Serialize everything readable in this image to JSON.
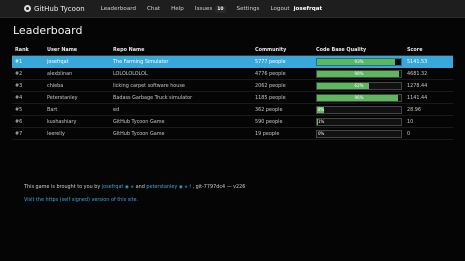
{
  "navbar": {
    "brand": "GitHub Tycoon",
    "items": [
      {
        "label": "Leaderboard"
      },
      {
        "label": "Chat"
      },
      {
        "label": "Help"
      },
      {
        "label": "Issues",
        "badge": "10"
      },
      {
        "label": "Settings"
      },
      {
        "label": "Logout"
      }
    ],
    "user": "josefrqat"
  },
  "page": {
    "title": "Leaderboard"
  },
  "table": {
    "headers": [
      "Rank",
      "User Name",
      "Repo Name",
      "Community",
      "Code Base Quality",
      "Score"
    ],
    "rows": [
      {
        "rank": "#1",
        "user": "josefrqat",
        "repo": "The Farming Simulator",
        "community": "5777 people",
        "quality_label": "93%",
        "quality": 93,
        "score": "5141.53",
        "highlight": true
      },
      {
        "rank": "#2",
        "user": "alexblinan",
        "repo": "LOLOLOLOLOL",
        "community": "4776 people",
        "quality_label": "98%",
        "quality": 98,
        "score": "4681.32",
        "highlight": false
      },
      {
        "rank": "#3",
        "user": "chieba",
        "repo": "licking carpet software house",
        "community": "2062 people",
        "quality_label": "62%",
        "quality": 62,
        "score": "1278.44",
        "highlight": false
      },
      {
        "rank": "#4",
        "user": "Peterstanley",
        "repo": "Badass Garbage Truck simulator",
        "community": "1185 people",
        "quality_label": "96%",
        "quality": 96,
        "score": "1141.44",
        "highlight": false
      },
      {
        "rank": "#5",
        "user": "Bart",
        "repo": "ed",
        "community": "362 people",
        "quality_label": "8%",
        "quality": 8,
        "score": "28.96",
        "highlight": false
      },
      {
        "rank": "#6",
        "user": "kushashiary",
        "repo": "GitHub Tycoon Game",
        "community": "590 people",
        "quality_label": "1%",
        "quality": 1,
        "score": "10",
        "highlight": false
      },
      {
        "rank": "#7",
        "user": "leerelly",
        "repo": "GitHub Tycoon Game",
        "community": "19 people",
        "quality_label": "0%",
        "quality": 0,
        "score": "0",
        "highlight": false
      }
    ]
  },
  "footer": {
    "prefix": "This game is brought to you by",
    "author1": "josefrqat",
    "author1_links": "GitHub Twitter",
    "conj": "and",
    "author2": "peterstanley",
    "author2_links": "GitHub Twitter Facebook",
    "version": ", git-7797dc4 — v226",
    "secure_link": "Visit the https (self signed) version of this site."
  },
  "colors": {
    "highlight": "#39a7d9",
    "bar": "#5cb85c",
    "link": "#3fa6db"
  }
}
